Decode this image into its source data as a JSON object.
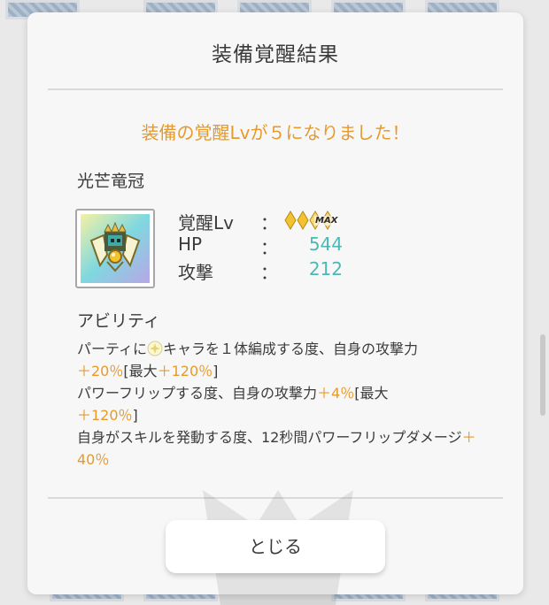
{
  "dialog": {
    "title": "装備覚醒結果",
    "message": "装備の覚醒Lvが５になりました！"
  },
  "item": {
    "name": "光芒竜冠",
    "icon": "dragon-crown-item-icon"
  },
  "stats": {
    "awakening_label": "覚醒Lv",
    "awakening_colon": "：",
    "awakening_badge": "MAX",
    "awakening_gems_filled": 2,
    "awakening_gems_total": 4,
    "hp_label": "HP",
    "hp_colon": "：",
    "hp_value": "544",
    "attack_label": "攻撃",
    "attack_colon": "：",
    "attack_value": "212"
  },
  "ability": {
    "title": "アビリティ",
    "line1_a": "パーティに",
    "line1_b": "キャラを１体編成する度、自身の攻撃力",
    "line1_val": "＋20％",
    "line1_c": "[最大",
    "line1_max": "＋120％",
    "line1_d": "]",
    "line2_a": "パワーフリップする度、自身の攻撃力",
    "line2_val": "＋4％",
    "line2_c": "[最大",
    "line2_max": "＋120％",
    "line2_d": "]",
    "line3_a": "自身がスキルを発動する度、12秒間パワーフリップダメージ",
    "line3_val": "＋40％"
  },
  "buttons": {
    "close_label": "とじる"
  },
  "colors": {
    "accent_orange": "#e69a2b",
    "value_teal": "#4bb8b4",
    "gem_gold": "#f2c230"
  }
}
